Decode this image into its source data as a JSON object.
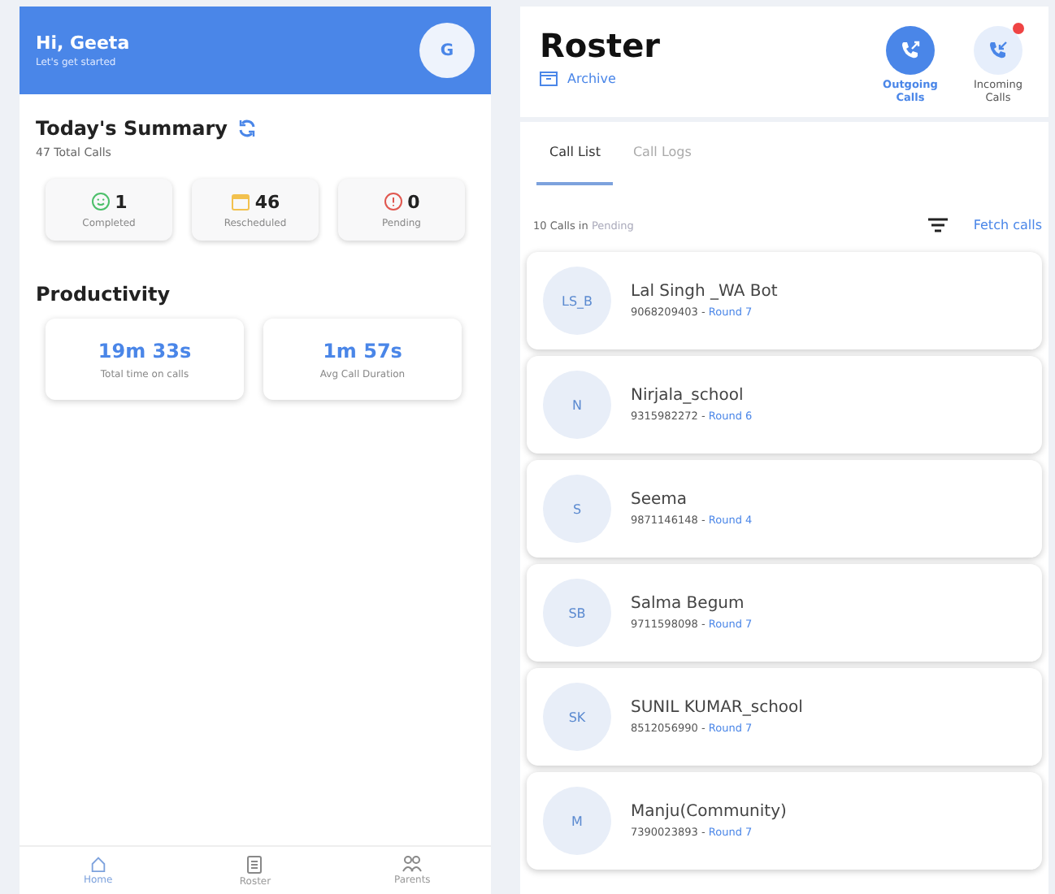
{
  "home": {
    "greeting": "Hi, Geeta",
    "subtitle": "Let's get started",
    "avatar": "G",
    "summary": {
      "title": "Today's Summary",
      "total": "47 Total Calls",
      "stats": [
        {
          "kind": "completed",
          "value": "1",
          "label": "Completed",
          "color": "#4cbf6a"
        },
        {
          "kind": "rescheduled",
          "value": "46",
          "label": "Rescheduled",
          "color": "#f2c14e"
        },
        {
          "kind": "pending",
          "value": "0",
          "label": "Pending",
          "color": "#e0574f"
        }
      ]
    },
    "productivity": {
      "title": "Productivity",
      "cards": [
        {
          "value": "19m 33s",
          "label": "Total time on calls"
        },
        {
          "value": "1m 57s",
          "label": "Avg Call Duration"
        }
      ]
    },
    "nav": [
      {
        "kind": "home",
        "label": "Home",
        "selected": true
      },
      {
        "kind": "roster",
        "label": "Roster",
        "selected": false
      },
      {
        "kind": "parents",
        "label": "Parents",
        "selected": false
      }
    ]
  },
  "roster": {
    "title": "Roster",
    "archive": "Archive",
    "call_modes": [
      {
        "kind": "outgoing",
        "label": "Outgoing Calls",
        "selected": true,
        "notification": false
      },
      {
        "kind": "incoming",
        "label": "Incoming Calls",
        "selected": false,
        "notification": true
      }
    ],
    "tabs": [
      {
        "label": "Call List",
        "selected": true
      },
      {
        "label": "Call Logs",
        "selected": false
      }
    ],
    "count": "10 Calls in",
    "status": "Pending",
    "fetch": "Fetch calls",
    "contacts": [
      {
        "initials": "LS_B",
        "name": "Lal Singh _WA Bot",
        "phone": "9068209403",
        "separator": "-",
        "round": "Round 7"
      },
      {
        "initials": "N",
        "name": "Nirjala_school",
        "phone": "9315982272",
        "separator": "-",
        "round": "Round 6"
      },
      {
        "initials": "S",
        "name": "Seema",
        "phone": "9871146148",
        "separator": "-",
        "round": "Round 4"
      },
      {
        "initials": "SB",
        "name": "Salma Begum",
        "phone": "9711598098",
        "separator": "-",
        "round": "Round 7"
      },
      {
        "initials": "SK",
        "name": "SUNIL KUMAR_school",
        "phone": "8512056990",
        "separator": "-",
        "round": "Round 7"
      },
      {
        "initials": "M",
        "name": "Manju(Community)",
        "phone": "7390023893",
        "separator": "-",
        "round": "Round 7"
      }
    ]
  }
}
